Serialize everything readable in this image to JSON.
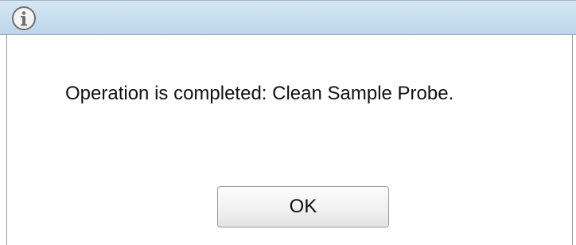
{
  "dialog": {
    "icon": "info-icon",
    "message": "Operation is completed: Clean Sample Probe.",
    "ok_label": "OK"
  },
  "colors": {
    "titlebar": "#c9def0",
    "frame_border": "#9a9a9a",
    "text": "#111111"
  }
}
